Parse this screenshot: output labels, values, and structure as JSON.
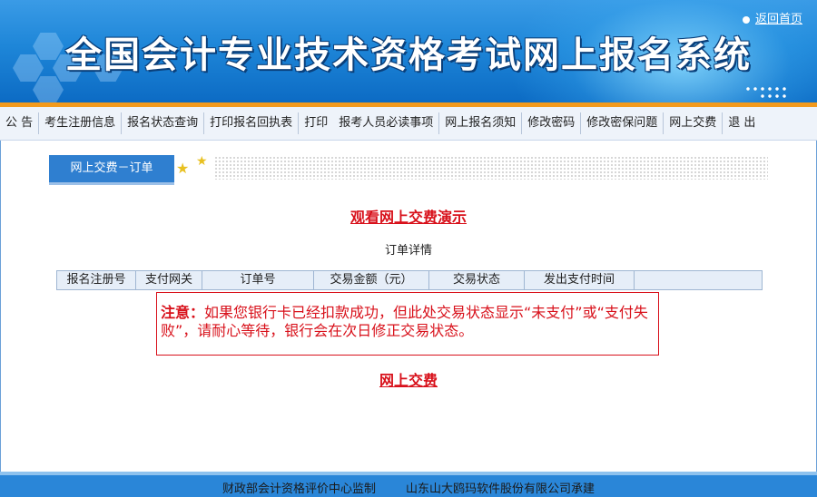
{
  "header": {
    "title": "全国会计专业技术资格考试网上报名系统",
    "home_link": "返回首页"
  },
  "nav": {
    "items": [
      {
        "label": "公 告"
      },
      {
        "label": "考生注册信息"
      },
      {
        "label": "报名状态查询"
      },
      {
        "label": "打印报名回执表"
      },
      {
        "label": "打印"
      },
      {
        "label": "报考人员必读事项"
      },
      {
        "label": "网上报名须知"
      },
      {
        "label": "修改密码"
      },
      {
        "label": "修改密保问题"
      },
      {
        "label": "网上交费"
      },
      {
        "label": "退 出"
      }
    ]
  },
  "tab": {
    "label": "网上交费－订单"
  },
  "main": {
    "demo_link": "观看网上交费演示",
    "order_caption": "订单详情",
    "table_headers": [
      "报名注册号",
      "支付网关",
      "订单号",
      "交易金额（元）",
      "交易状态",
      "发出支付时间",
      ""
    ],
    "notice_label": "注意：",
    "notice_text": "如果您银行卡已经扣款成功，但此处交易状态显示“未支付”或“支付失败”，请耐心等待，银行会在次日修正交易状态。",
    "pay_link": "网上交费"
  },
  "footer": {
    "text": "财政部会计资格评价中心监制        山东山大鸥玛软件股份有限公司承建"
  },
  "colors": {
    "banner_blue": "#1e86d8",
    "accent_orange": "#f39a1c",
    "link_red": "#d8101a",
    "tab_blue": "#2f7fd0"
  },
  "icons": [
    "star-icon",
    "bullet-icon"
  ]
}
